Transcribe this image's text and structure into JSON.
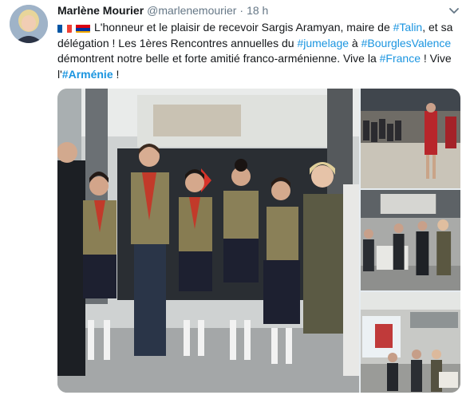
{
  "author": {
    "name": "Marlène Mourier",
    "handle": "@marlenemourier",
    "separator": "·",
    "time": "18 h"
  },
  "tweet": {
    "line1": [
      {
        "type": "flag",
        "icon": "france-flag-icon"
      },
      {
        "type": "flag",
        "icon": "armenia-flag-icon"
      },
      {
        "type": "text",
        "value": "L'honneur et le plaisir de recevoir Sargis Aramyan, maire de "
      },
      {
        "type": "tag",
        "value": "#Talin"
      },
      {
        "type": "text",
        "value": ", et sa"
      }
    ],
    "line2": [
      {
        "type": "text",
        "value": "délégation ! Les 1ères Rencontres annuelles du "
      },
      {
        "type": "tag",
        "value": "#jumelage"
      },
      {
        "type": "text",
        "value": " à "
      },
      {
        "type": "tag",
        "value": "#BourglesValence"
      }
    ],
    "line3": [
      {
        "type": "text",
        "value": "démontrent notre belle et forte amitié franco-arménienne. Vive la "
      },
      {
        "type": "tag",
        "value": "#France"
      },
      {
        "type": "text",
        "value": " ! Vive"
      }
    ],
    "line4": [
      {
        "type": "text",
        "value": "l'"
      },
      {
        "type": "tag-bold",
        "value": "#Arménie"
      },
      {
        "type": "text",
        "value": " !"
      }
    ]
  },
  "media": {
    "photo_count": 4,
    "photos": [
      {
        "icon": "group-photo-scouts"
      },
      {
        "icon": "dancers-photo"
      },
      {
        "icon": "ceremony-photo"
      },
      {
        "icon": "exhibition-photo"
      }
    ]
  },
  "colors": {
    "link": "#1b95e0",
    "secondary_text": "#657786",
    "primary_text": "#14171a"
  }
}
